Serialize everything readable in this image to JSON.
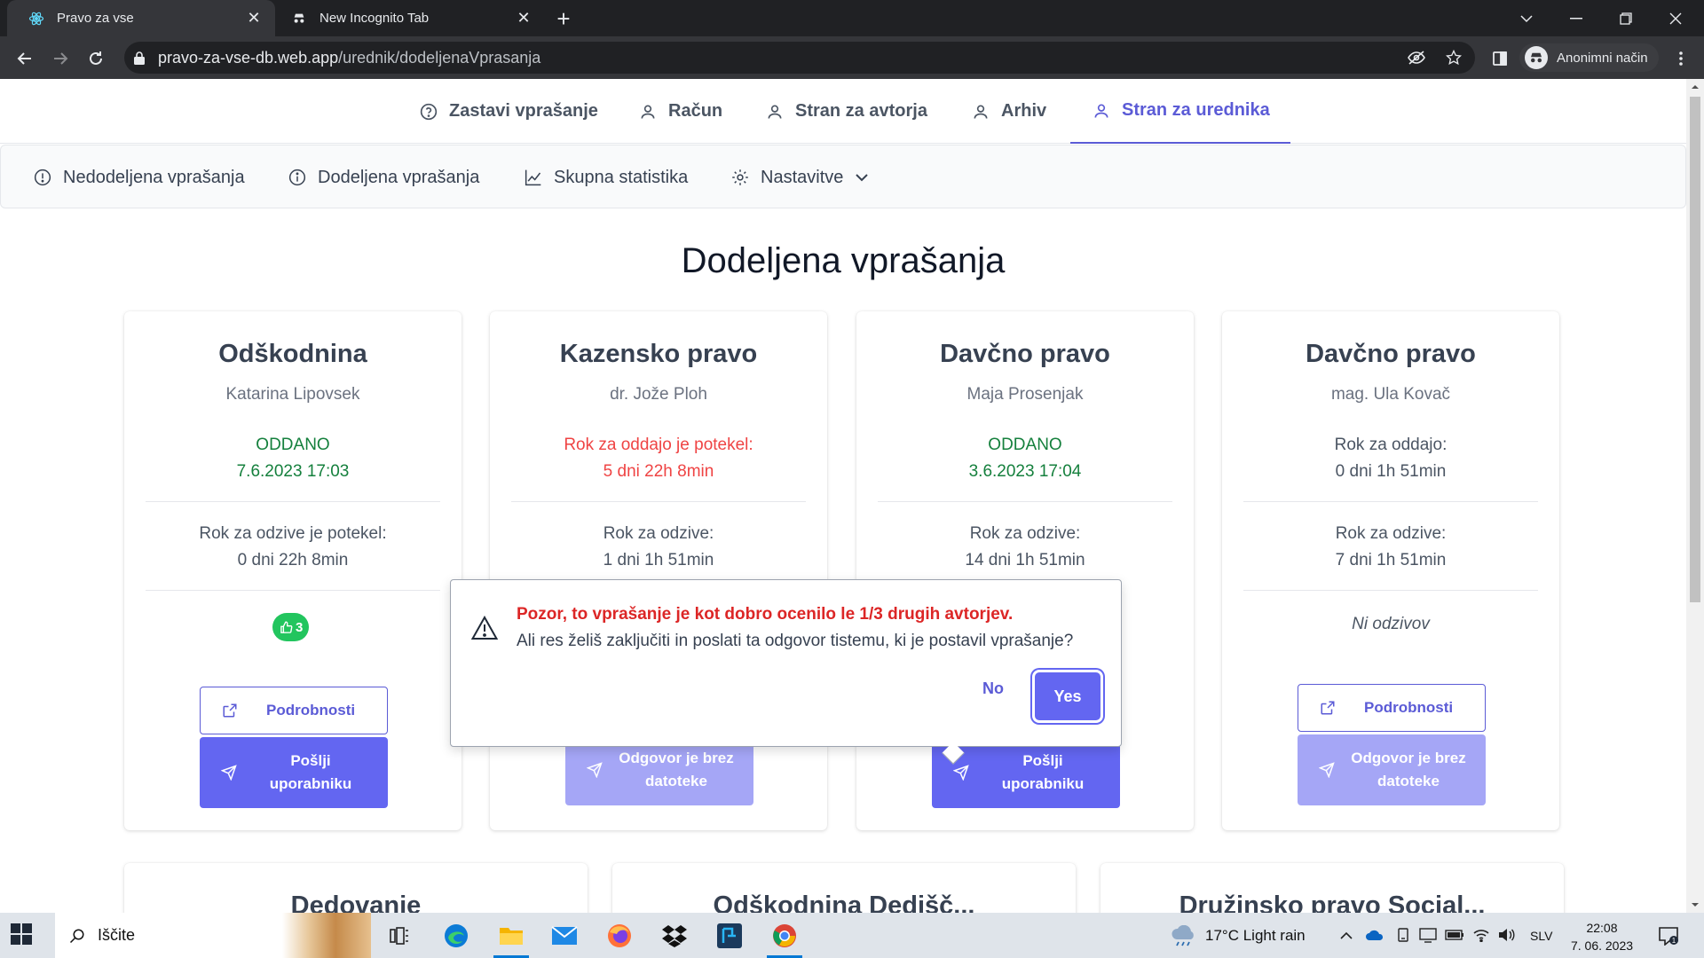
{
  "browser": {
    "tabs": [
      {
        "title": "Pravo za vse",
        "icon": "react-icon",
        "active": true
      },
      {
        "title": "New Incognito Tab",
        "icon": "incognito-icon",
        "active": false
      }
    ],
    "url_host": "pravo-za-vse-db.web.app",
    "url_path": "/urednik/dodeljenaVprasanja",
    "profile_label": "Anonimni način"
  },
  "topnav": {
    "items": [
      {
        "label": "Zastavi vprašanje",
        "icon": "question-circle-icon"
      },
      {
        "label": "Račun",
        "icon": "user-icon"
      },
      {
        "label": "Stran za avtorja",
        "icon": "user-icon"
      },
      {
        "label": "Arhiv",
        "icon": "user-icon"
      },
      {
        "label": "Stran za urednika",
        "icon": "user-icon",
        "active": true
      }
    ]
  },
  "subnav": {
    "items": [
      {
        "label": "Nedodeljena vprašanja",
        "icon": "exclamation-circle-icon"
      },
      {
        "label": "Dodeljena vprašanja",
        "icon": "info-circle-icon"
      },
      {
        "label": "Skupna statistika",
        "icon": "line-chart-icon"
      },
      {
        "label": "Nastavitve",
        "icon": "gear-icon"
      }
    ]
  },
  "page_title": "Dodeljena vprašanja",
  "cards": [
    {
      "title": "Odškodnina",
      "author": "Katarina Lipovsek",
      "status_line1": "ODDANO",
      "status_line2": "7.6.2023 17:03",
      "rok_line1": "Rok za odzive je potekel:",
      "rok_line2": "0 dni 22h 8min",
      "likes": "3",
      "details_label": "Podrobnosti",
      "send_label": "Pošlji uporabniku"
    },
    {
      "title": "Kazensko pravo",
      "author": "dr. Jože Ploh",
      "status_line1": "Rok za oddajo je potekel:",
      "status_line2": "5 dni 22h 8min",
      "rok_line1": "Rok za odzive:",
      "rok_line2": "1 dni 1h 51min",
      "no_file_label": "Odgovor je brez datoteke"
    },
    {
      "title": "Davčno pravo",
      "author": "Maja Prosenjak",
      "status_line1": "ODDANO",
      "status_line2": "3.6.2023 17:04",
      "rok_line1": "Rok za odzive:",
      "rok_line2": "14 dni 1h 51min",
      "send_label": "Pošlji uporabniku"
    },
    {
      "title": "Davčno pravo",
      "author": "mag. Ula Kovač",
      "status_line1": "Rok za oddajo:",
      "status_line2": "0 dni 1h 51min",
      "rok_line1": "Rok za odzive:",
      "rok_line2": "7 dni 1h 51min",
      "no_responses": "Ni odzivov",
      "details_label": "Podrobnosti",
      "no_file_label": "Odgovor je brez datoteke"
    }
  ],
  "lower_cards": [
    {
      "title": "Dedovanje"
    },
    {
      "title": "Odškodnina Dedišč..."
    },
    {
      "title": "Družinsko pravo Social..."
    }
  ],
  "popconfirm": {
    "title": "Pozor, to vprašanje je kot dobro ocenilo le 1/3 drugih avtorjev.",
    "message": "Ali res želiš zaključiti in poslati ta odgovor tistemu, ki je postavil vprašanje?",
    "no_label": "No",
    "yes_label": "Yes"
  },
  "taskbar": {
    "search_placeholder": "Iščite",
    "weather": "17°C  Light rain",
    "language": "SLV",
    "time": "22:08",
    "date": "7. 06. 2023"
  },
  "colors": {
    "accent": "#6366f1",
    "success": "#15803d",
    "danger": "#ef4444",
    "link_blue": "#2563eb"
  }
}
